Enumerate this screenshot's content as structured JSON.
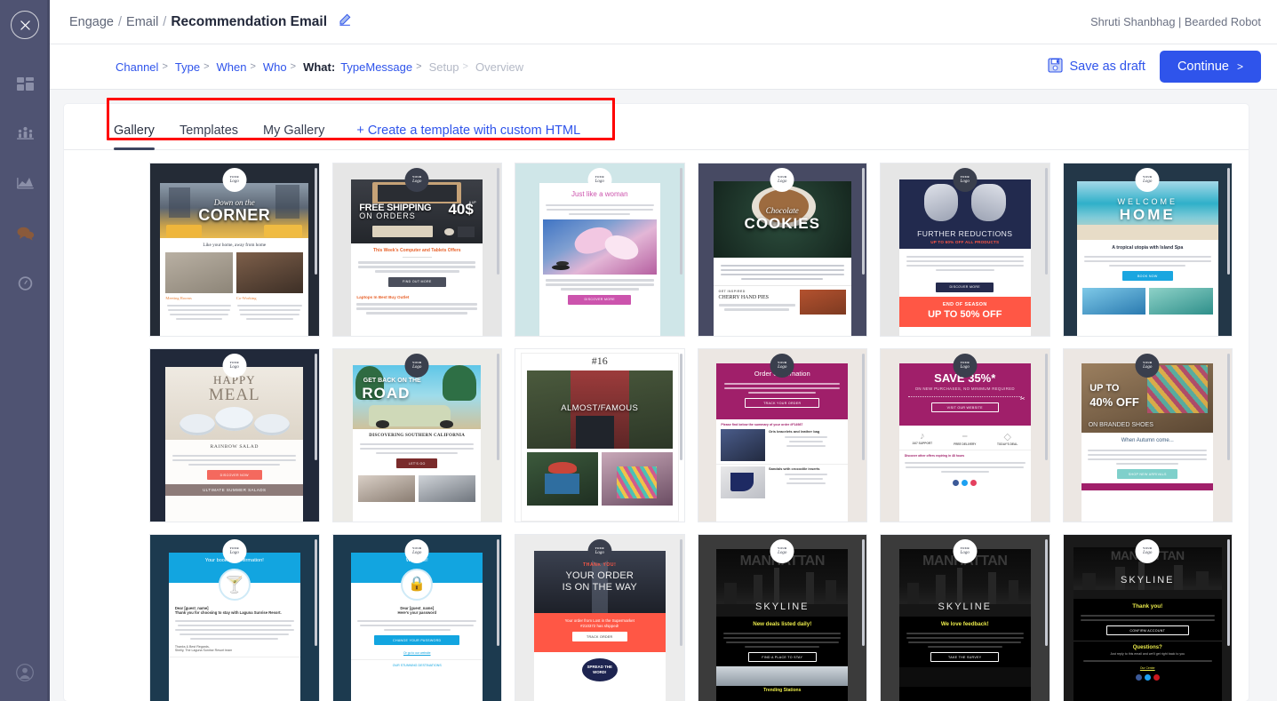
{
  "sidebar": {
    "close_label": "Close",
    "items": [
      {
        "name": "dashboard",
        "icon": "grid-icon",
        "active": false
      },
      {
        "name": "audience",
        "icon": "people-bar-chart-icon",
        "active": false
      },
      {
        "name": "analyze",
        "icon": "area-chart-icon",
        "active": false
      },
      {
        "name": "engage",
        "icon": "chat-bubbles-icon",
        "active": true
      },
      {
        "name": "monitor",
        "icon": "speedometer-icon",
        "active": false
      }
    ],
    "account_icon": "user-avatar-icon",
    "active_color": "#8a5a3b"
  },
  "header": {
    "breadcrumb": {
      "level1": "Engage",
      "sep": "/",
      "level2": "Email",
      "current": "Recommendation Email"
    },
    "edit_icon": "pencil-icon",
    "account": "Shruti Shanbhag | Bearded Robot"
  },
  "steps": [
    {
      "label": "Channel",
      "state": "link",
      "chevron": ">"
    },
    {
      "label": "Type",
      "state": "link",
      "chevron": ">"
    },
    {
      "label": "When",
      "state": "link",
      "chevron": ">"
    },
    {
      "label": "Who",
      "state": "link",
      "chevron": ">"
    },
    {
      "label": "What:",
      "state": "current-label",
      "chevron": ""
    },
    {
      "label": "Type",
      "state": "link",
      "chevron": ""
    },
    {
      "label": "Message",
      "state": "link",
      "chevron": ">"
    },
    {
      "label": "Setup",
      "state": "disabled",
      "chevron": ">"
    },
    {
      "label": "Overview",
      "state": "disabled",
      "chevron": ""
    }
  ],
  "actions": {
    "save_draft": "Save as draft",
    "save_icon": "floppy-disk-icon",
    "continue": "Continue",
    "continue_chevron": ">",
    "accent": "#2f54eb"
  },
  "tabs": [
    {
      "label": "Gallery",
      "active": true,
      "style": "tab"
    },
    {
      "label": "Templates",
      "active": false,
      "style": "tab"
    },
    {
      "label": "My Gallery",
      "active": false,
      "style": "tab"
    },
    {
      "label": "+ Create a template with custom HTML",
      "active": false,
      "style": "link"
    }
  ],
  "highlight": {
    "color": "#ff0000",
    "target": "tab-bar"
  },
  "logo_text": {
    "top": "YOUR",
    "main": "Logo"
  },
  "gallery": [
    {
      "id": 1,
      "title_script": "Down on the",
      "title": "CORNER",
      "subtitle": "Like your home, away from home",
      "sections": [
        "Meeting Rooms",
        "Co-Working"
      ],
      "bg": "#242b36",
      "frame_bg": "#ffffff",
      "accent": "#e8823c",
      "hero": "city-street-taxis",
      "logo": "white"
    },
    {
      "id": 2,
      "title": "FREE SHIPPING",
      "title2": "ON ORDERS",
      "badge": "40$",
      "badge_note": "& UP",
      "heading": "This Week's Computer and Tablets Offers",
      "button": "FIND OUT MORE",
      "section2": "Laptops In Best Buy Outlet",
      "bg": "#e6e6e6",
      "frame_bg": "#ffffff",
      "accent": "#e8632c",
      "hero": "desk-keyboard",
      "logo": "dark"
    },
    {
      "id": 3,
      "title": "Just like a woman",
      "button": "DISCOVER MORE",
      "bg": "#cfe6e8",
      "frame_bg": "#ffffff",
      "accent": "#cc54ad",
      "hero": "pink-orchids",
      "logo": "white"
    },
    {
      "id": 4,
      "title_script": "Chocolate",
      "title": "COOKIES",
      "section": "GET INSPIRED",
      "section_title": "CHERRY HAND PIES",
      "bg": "#474a63",
      "frame_bg": "#ffffff",
      "accent": "#3b3f52",
      "hero": "chocolate-cookies",
      "logo": "white"
    },
    {
      "id": 5,
      "title": "FURTHER REDUCTIONS",
      "subtitle": "UP TO 60% OFF ALL PRODUCTS",
      "button": "DISCOVER MORE",
      "banner1": "END OF SEASON",
      "banner2": "UP TO 50% OFF",
      "bg": "#e6e6e6",
      "frame_bg": "#ffffff",
      "accent": "#ff5745",
      "hero": "sneakers-navy",
      "logo": "dark"
    },
    {
      "id": 6,
      "title": "WELCOME",
      "title2": "HOME",
      "heading": "A tropical utopia with Island Spa",
      "button": "BOOK NOW",
      "bg": "#233748",
      "frame_bg": "#ffffff",
      "accent": "#1aa6e0",
      "hero": "beach-turquoise",
      "logo": "white"
    },
    {
      "id": 7,
      "title": "HAPPY",
      "title2": "MEAL",
      "heading": "RAINBOW SALAD",
      "button": "DISCOVER NOW",
      "footer": "ULTIMATE SUMMER SALADS",
      "bg": "#21293a",
      "frame_bg": "#ffffff",
      "accent": "#f4695e",
      "hero": "soup-bowls",
      "logo": "white"
    },
    {
      "id": 8,
      "title": "GET BACK ON THE",
      "title2": "ROAD",
      "heading": "DISCOVERING SOUTHERN CALIFORNIA",
      "button": "LET'S GO",
      "bg": "#ecebe7",
      "frame_bg": "#ffffff",
      "accent": "#7a2b2b",
      "hero": "van-palms",
      "logo": "dark"
    },
    {
      "id": 9,
      "issue": "#16",
      "title": "ALMOST/FAMOUS",
      "bg": "#ffffff",
      "frame_bg": "#ffffff",
      "accent": "#2a2a2a",
      "hero": "plaid-forest",
      "logo": "none"
    },
    {
      "id": 10,
      "title": "Order confirmation",
      "button": "TRACK YOUR ORDER",
      "note": "Please find below the summary of your order #F14987",
      "item1": "Oris bracelets and leather bag",
      "item2": "Sandals with crocodile inserts",
      "bg": "#ece7e3",
      "frame_bg": "#ffffff",
      "accent": "#a01f6a",
      "hero": "magenta-band",
      "logo": "dark"
    },
    {
      "id": 11,
      "title": "SAVE 35%*",
      "subtitle": "ON NEW PURCHASES, NO MINIMUM REQUIRED",
      "button": "VISIT OUR WEBSITE",
      "features": [
        "24/7 SUPPORT",
        "FREE DELIVERY",
        "TODAY'S DEAL"
      ],
      "note": "Discover other offers expiring in 48 hours",
      "bg": "#ece7e3",
      "frame_bg": "#ffffff",
      "accent": "#a01f6a",
      "hero": "magenta-coupon",
      "logo": "dark"
    },
    {
      "id": 12,
      "title": "UP TO",
      "title2": "40% OFF",
      "title3": "ON BRANDED SHOES",
      "heading": "When Autumn come...",
      "button": "SHOP NEW ARRIVALS",
      "bg": "#ece7e3",
      "frame_bg": "#ffffff",
      "accent": "#7fd0cb",
      "hero": "autumn-scarf",
      "logo": "dark"
    },
    {
      "id": 13,
      "title": "Your booking confirmation!",
      "icon": "cocktail-glass-icon",
      "greeting": "Dear [guest_name]",
      "line1": "Thank you for choosing to stay with Laguna Sunrise Resort.",
      "sign": "Thanks & Best Regards,",
      "sign2": "Shelly, The Laguna Sunrise Resort team",
      "bg": "#1c3a4f",
      "frame_bg": "#ffffff",
      "accent": "#12a5e0",
      "hero": "blue-band",
      "logo": "white"
    },
    {
      "id": 14,
      "title": "Welcome!",
      "icon": "lock-icon",
      "greeting": "Dear [guest_name]",
      "line1": "Here's your password",
      "button": "CHANGE YOUR PASSWORD",
      "link": "Or go to our website",
      "footer": "OUR STUNNING DESTINATIONS",
      "bg": "#1c3a4f",
      "frame_bg": "#ffffff",
      "accent": "#12a5e0",
      "hero": "blue-band",
      "logo": "white"
    },
    {
      "id": 15,
      "kicker": "THANK YOU!",
      "title": "YOUR ORDER",
      "title2": "IS ON THE WAY",
      "banner1": "Your order from Lost in the Supermarket",
      "banner2": "#210372 has shipped!",
      "button": "TRACK ORDER",
      "badge": "SPREAD THE WORD!",
      "bg": "#ececec",
      "frame_bg": "#ffffff",
      "accent": "#ff5745",
      "hero": "dark-forest-road",
      "logo": "dark"
    },
    {
      "id": 16,
      "title": "MANHATTAN",
      "title2": "SKYLINE",
      "heading": "New deals listed daily!",
      "button": "FIND A PLACE TO STAY",
      "footer": "Trending Stations",
      "bg": "#3b3b3b",
      "frame_bg": "#000000",
      "accent": "#e9e94a",
      "hero": "manhattan-night",
      "logo": "white"
    },
    {
      "id": 17,
      "title": "MANHATTAN",
      "title2": "SKYLINE",
      "heading": "We love feedback!",
      "button": "TAKE THE SURVEY",
      "bg": "#3b3b3b",
      "frame_bg": "#000000",
      "accent": "#e9e94a",
      "hero": "manhattan-night",
      "logo": "white"
    },
    {
      "id": 18,
      "title": "MANHATTAN",
      "title2": "SKYLINE",
      "heading": "Thank you!",
      "button": "CONFIRM ACCOUNT",
      "heading2": "Questions?",
      "line": "Just reply to this email and we'll get right back to you",
      "link": "Our Center",
      "bg": "#1a1a1a",
      "frame_bg": "#000000",
      "accent": "#e9e94a",
      "hero": "manhattan-night",
      "logo": "white"
    }
  ]
}
